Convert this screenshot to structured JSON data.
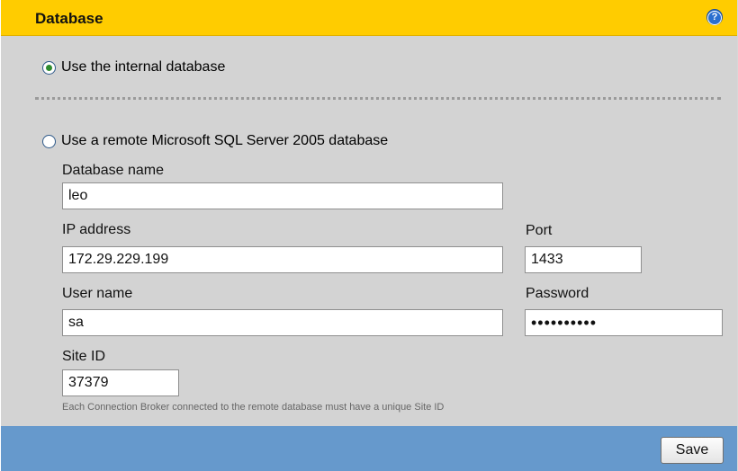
{
  "header": {
    "title": "Database",
    "help_icon": "help-question-icon",
    "help_glyph": "?"
  },
  "options": {
    "internal": {
      "label": "Use the internal database",
      "selected": true
    },
    "remote": {
      "label": "Use a remote Microsoft SQL Server 2005 database",
      "selected": false
    }
  },
  "form": {
    "database_name": {
      "label": "Database name",
      "value": "leo"
    },
    "ip_address": {
      "label": "IP address",
      "value": "172.29.229.199"
    },
    "port": {
      "label": "Port",
      "value": "1433"
    },
    "user_name": {
      "label": "User name",
      "value": "sa"
    },
    "password": {
      "label": "Password",
      "value": "••••••••••"
    },
    "site_id": {
      "label": "Site ID",
      "value": "37379"
    },
    "hint": "Each Connection Broker connected to the remote database must have a unique Site ID"
  },
  "footer": {
    "save_label": "Save"
  },
  "colors": {
    "header_bg": "#ffcc00",
    "panel_bg": "#d3d3d3",
    "footer_bg": "#6699cc"
  }
}
